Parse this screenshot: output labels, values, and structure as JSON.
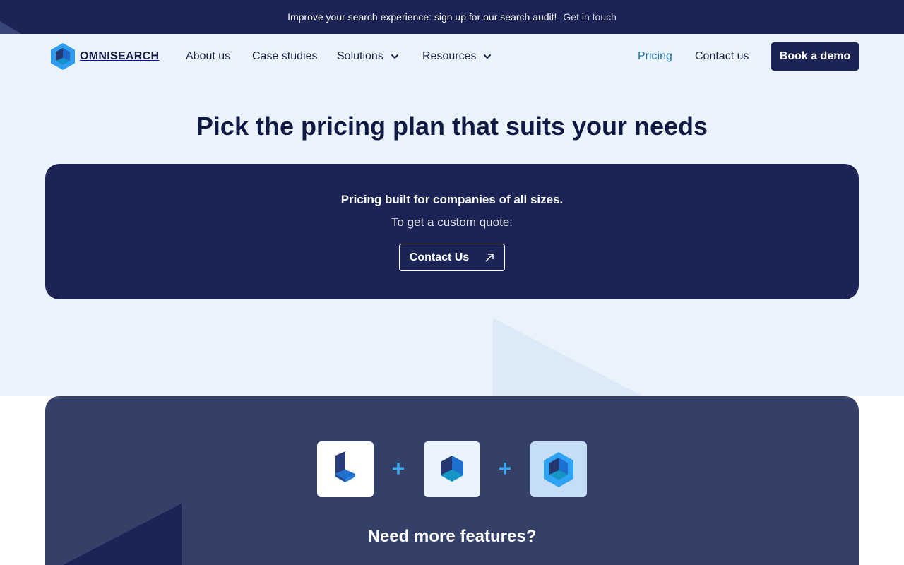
{
  "announcement": {
    "message": "Improve your search experience: sign up for our search audit!",
    "link_label": "Get in touch"
  },
  "brand": {
    "name": "OMNISEARCH",
    "logo_icon": "hexagon-cube-logo-icon"
  },
  "nav": {
    "items": [
      {
        "label": "About us",
        "has_dropdown": false
      },
      {
        "label": "Case studies",
        "has_dropdown": false
      },
      {
        "label": "Solutions",
        "has_dropdown": true
      },
      {
        "label": "Resources",
        "has_dropdown": true
      }
    ],
    "pricing_label": "Pricing",
    "contact_label": "Contact us",
    "book_demo_label": "Book a demo",
    "active_item": "Pricing"
  },
  "hero": {
    "headline": "Pick the pricing plan that suits your needs"
  },
  "quote_card": {
    "line1": "Pricing built for companies of all sizes.",
    "line2": "To get a custom quote:",
    "button_label": "Contact Us",
    "button_icon": "arrow-up-right-icon"
  },
  "features": {
    "products": [
      {
        "icon": "product-base-icon"
      },
      {
        "icon": "product-cube-icon"
      },
      {
        "icon": "product-hexagon-cube-icon"
      }
    ],
    "plus_symbol": "+",
    "heading": "Need more features?"
  },
  "colors": {
    "navy": "#1b2455",
    "hero_bg": "#eaf3fb",
    "features_bg": "#344067",
    "accent_blue": "#3fa8ee",
    "active_link": "#1d6fa8"
  }
}
